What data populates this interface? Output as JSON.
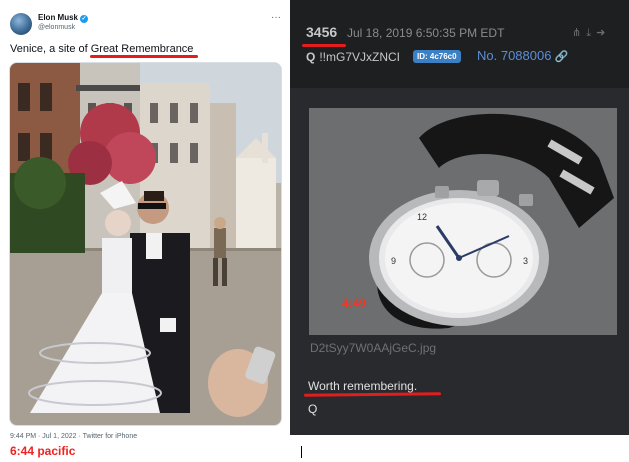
{
  "tweet": {
    "author_name": "Elon Musk",
    "handle": "@elonmusk",
    "more_icon": "more-horizontal-icon",
    "text_prefix": "Venice, a site of ",
    "text_highlight": "Great Remembrance",
    "timestamp": "9:44 PM · Jul 1, 2022 · Twitter for iPhone",
    "annotation": "6:44 pacific"
  },
  "qpost": {
    "post_number": "3456",
    "datetime": "Jul 18, 2019 6:50:35 PM EDT",
    "author": "Q",
    "tripcode": "!!mG7VJxZNCI",
    "id_badge": "ID: 4c76c0",
    "post_no": "No. 7088006",
    "icons": [
      "share-icon",
      "download-icon",
      "arrow-right-icon"
    ],
    "watch_annotation": "4:49",
    "filename": "D2tSyy7W0AAjGeC.jpg",
    "message": "Worth remembering.",
    "signature": "Q"
  },
  "colors": {
    "annotation_red": "#e11d1d",
    "q_background": "#282a2e",
    "link_blue": "#5b8ed8",
    "id_badge_blue": "#3b7fc4"
  }
}
